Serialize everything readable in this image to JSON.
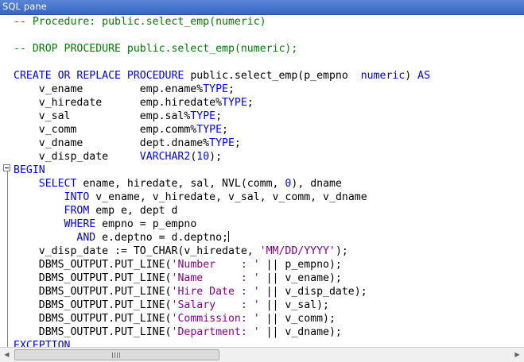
{
  "pane": {
    "title": "SQL pane"
  },
  "code": {
    "lines": [
      [
        {
          "t": "-- Procedure: public.select_emp(numeric)",
          "c": "cm"
        }
      ],
      [],
      [
        {
          "t": "-- DROP PROCEDURE public.select_emp(numeric);",
          "c": "cm"
        }
      ],
      [],
      [
        {
          "t": "CREATE OR REPLACE PROCEDURE",
          "c": "kw"
        },
        {
          "t": " public.select_emp(p_empno  ",
          "c": "nm"
        },
        {
          "t": "numeric",
          "c": "kw"
        },
        {
          "t": ") ",
          "c": "nm"
        },
        {
          "t": "AS",
          "c": "kw"
        }
      ],
      [
        {
          "t": "    v_ename         emp.ename%",
          "c": "nm"
        },
        {
          "t": "TYPE",
          "c": "kw"
        },
        {
          "t": ";",
          "c": "nm"
        }
      ],
      [
        {
          "t": "    v_hiredate      emp.hiredate%",
          "c": "nm"
        },
        {
          "t": "TYPE",
          "c": "kw"
        },
        {
          "t": ";",
          "c": "nm"
        }
      ],
      [
        {
          "t": "    v_sal           emp.sal%",
          "c": "nm"
        },
        {
          "t": "TYPE",
          "c": "kw"
        },
        {
          "t": ";",
          "c": "nm"
        }
      ],
      [
        {
          "t": "    v_comm          emp.comm%",
          "c": "nm"
        },
        {
          "t": "TYPE",
          "c": "kw"
        },
        {
          "t": ";",
          "c": "nm"
        }
      ],
      [
        {
          "t": "    v_dname         dept.dname%",
          "c": "nm"
        },
        {
          "t": "TYPE",
          "c": "kw"
        },
        {
          "t": ";",
          "c": "nm"
        }
      ],
      [
        {
          "t": "    v_disp_date     ",
          "c": "nm"
        },
        {
          "t": "VARCHAR2",
          "c": "kw"
        },
        {
          "t": "(",
          "c": "nm"
        },
        {
          "t": "10",
          "c": "kw"
        },
        {
          "t": ");",
          "c": "nm"
        }
      ],
      [
        {
          "t": "BEGIN",
          "c": "kw"
        }
      ],
      [
        {
          "t": "    ",
          "c": "nm"
        },
        {
          "t": "SELECT",
          "c": "kw"
        },
        {
          "t": " ename, hiredate, sal, NVL(comm, ",
          "c": "nm"
        },
        {
          "t": "0",
          "c": "kw"
        },
        {
          "t": "), dname",
          "c": "nm"
        }
      ],
      [
        {
          "t": "        ",
          "c": "nm"
        },
        {
          "t": "INTO",
          "c": "kw"
        },
        {
          "t": " v_ename, v_hiredate, v_sal, v_comm, v_dname",
          "c": "nm"
        }
      ],
      [
        {
          "t": "        ",
          "c": "nm"
        },
        {
          "t": "FROM",
          "c": "kw"
        },
        {
          "t": " emp e, dept d",
          "c": "nm"
        }
      ],
      [
        {
          "t": "        ",
          "c": "nm"
        },
        {
          "t": "WHERE",
          "c": "kw"
        },
        {
          "t": " empno = p_empno",
          "c": "nm"
        }
      ],
      [
        {
          "t": "          ",
          "c": "nm"
        },
        {
          "t": "AND",
          "c": "kw"
        },
        {
          "t": " e.deptno = d.deptno;",
          "c": "nm"
        },
        {
          "t": "",
          "c": "caret"
        }
      ],
      [
        {
          "t": "    v_disp_date := TO_CHAR(v_hiredate, ",
          "c": "nm"
        },
        {
          "t": "'MM/DD/YYYY'",
          "c": "st"
        },
        {
          "t": ");",
          "c": "nm"
        }
      ],
      [
        {
          "t": "    DBMS_OUTPUT.PUT_LINE(",
          "c": "nm"
        },
        {
          "t": "'Number    : '",
          "c": "st"
        },
        {
          "t": " || p_empno);",
          "c": "nm"
        }
      ],
      [
        {
          "t": "    DBMS_OUTPUT.PUT_LINE(",
          "c": "nm"
        },
        {
          "t": "'Name      : '",
          "c": "st"
        },
        {
          "t": " || v_ename);",
          "c": "nm"
        }
      ],
      [
        {
          "t": "    DBMS_OUTPUT.PUT_LINE(",
          "c": "nm"
        },
        {
          "t": "'Hire Date : '",
          "c": "st"
        },
        {
          "t": " || v_disp_date);",
          "c": "nm"
        }
      ],
      [
        {
          "t": "    DBMS_OUTPUT.PUT_LINE(",
          "c": "nm"
        },
        {
          "t": "'Salary    : '",
          "c": "st"
        },
        {
          "t": " || v_sal);",
          "c": "nm"
        }
      ],
      [
        {
          "t": "    DBMS_OUTPUT.PUT_LINE(",
          "c": "nm"
        },
        {
          "t": "'Commission: '",
          "c": "st"
        },
        {
          "t": " || v_comm);",
          "c": "nm"
        }
      ],
      [
        {
          "t": "    DBMS_OUTPUT.PUT_LINE(",
          "c": "nm"
        },
        {
          "t": "'Department: '",
          "c": "st"
        },
        {
          "t": " || v_dname);",
          "c": "nm"
        }
      ],
      [
        {
          "t": "EXCEPTION",
          "c": "kw"
        }
      ]
    ]
  },
  "scrollbar": {
    "left_arrow": "◀",
    "right_arrow": "▶",
    "thumb_grip": "grip-icon"
  },
  "colors": {
    "comment": "#008000",
    "keyword": "#0000ff",
    "string": "#8b008b",
    "title_bar": "#3566c6"
  }
}
